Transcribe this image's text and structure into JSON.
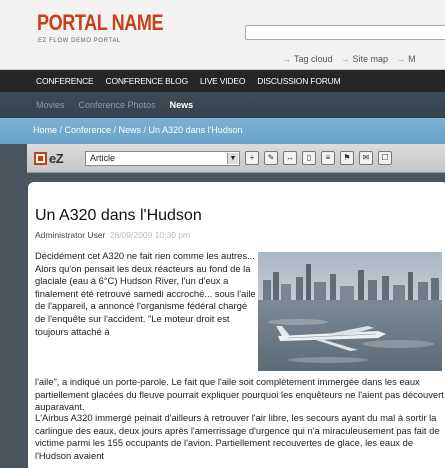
{
  "header": {
    "logo": "PORTAL NAME",
    "logo_sub": "EZ FLOW DEMO PORTAL",
    "links": [
      "Tag cloud",
      "Site map",
      "M"
    ]
  },
  "mainnav": [
    "CONFERENCE",
    "CONFERENCE BLOG",
    "LIVE VIDEO",
    "DISCUSSION FORUM"
  ],
  "subnav": [
    "Movies",
    "Conference Photos",
    "News"
  ],
  "breadcrumb": "Home / Conference / News / Un A320 dans l'Hudson",
  "toolbar": {
    "logo_text": "eZ",
    "select_value": "Article"
  },
  "article": {
    "title": "Un A320 dans l'Hudson",
    "author": "Administrator User",
    "date": "28/09/2009 10:30 pm",
    "para1": "Décidément cet A320 ne fait rien comme les autres... Alors qu'on pensait les deux réacteurs au fond de la glaciale (eau à 6°C) Hudson River, l'un d'eux a finalement été retrouvé samedi accroché... sous l'aile de l'appareil, a annoncé l'organisme fédéral chargé de l'enquête sur l'accident. \"Le moteur droit est toujours attaché à",
    "para1_cont": "l'aile\", a indiqué un porte-parole. Le fait que l'aile soit complètement immergée dans les eaux partiellement glacées du fleuve pourrait expliquer pourquoi les enquêteurs ne l'aient pas découvert auparavant.",
    "para2": "L'Airbus A320 immergé peinait d'ailleurs à retrouver l'air libre, les secours ayant du mal à sortir la carlingue des eaux, deux jours après l'amerrissage d'urgence qui n'a miraculeusement pas fait de victime parmi les 155 occupants de l'avion. Partiellement recouvertes de glace, les eaux de l'Hudson avaient"
  }
}
